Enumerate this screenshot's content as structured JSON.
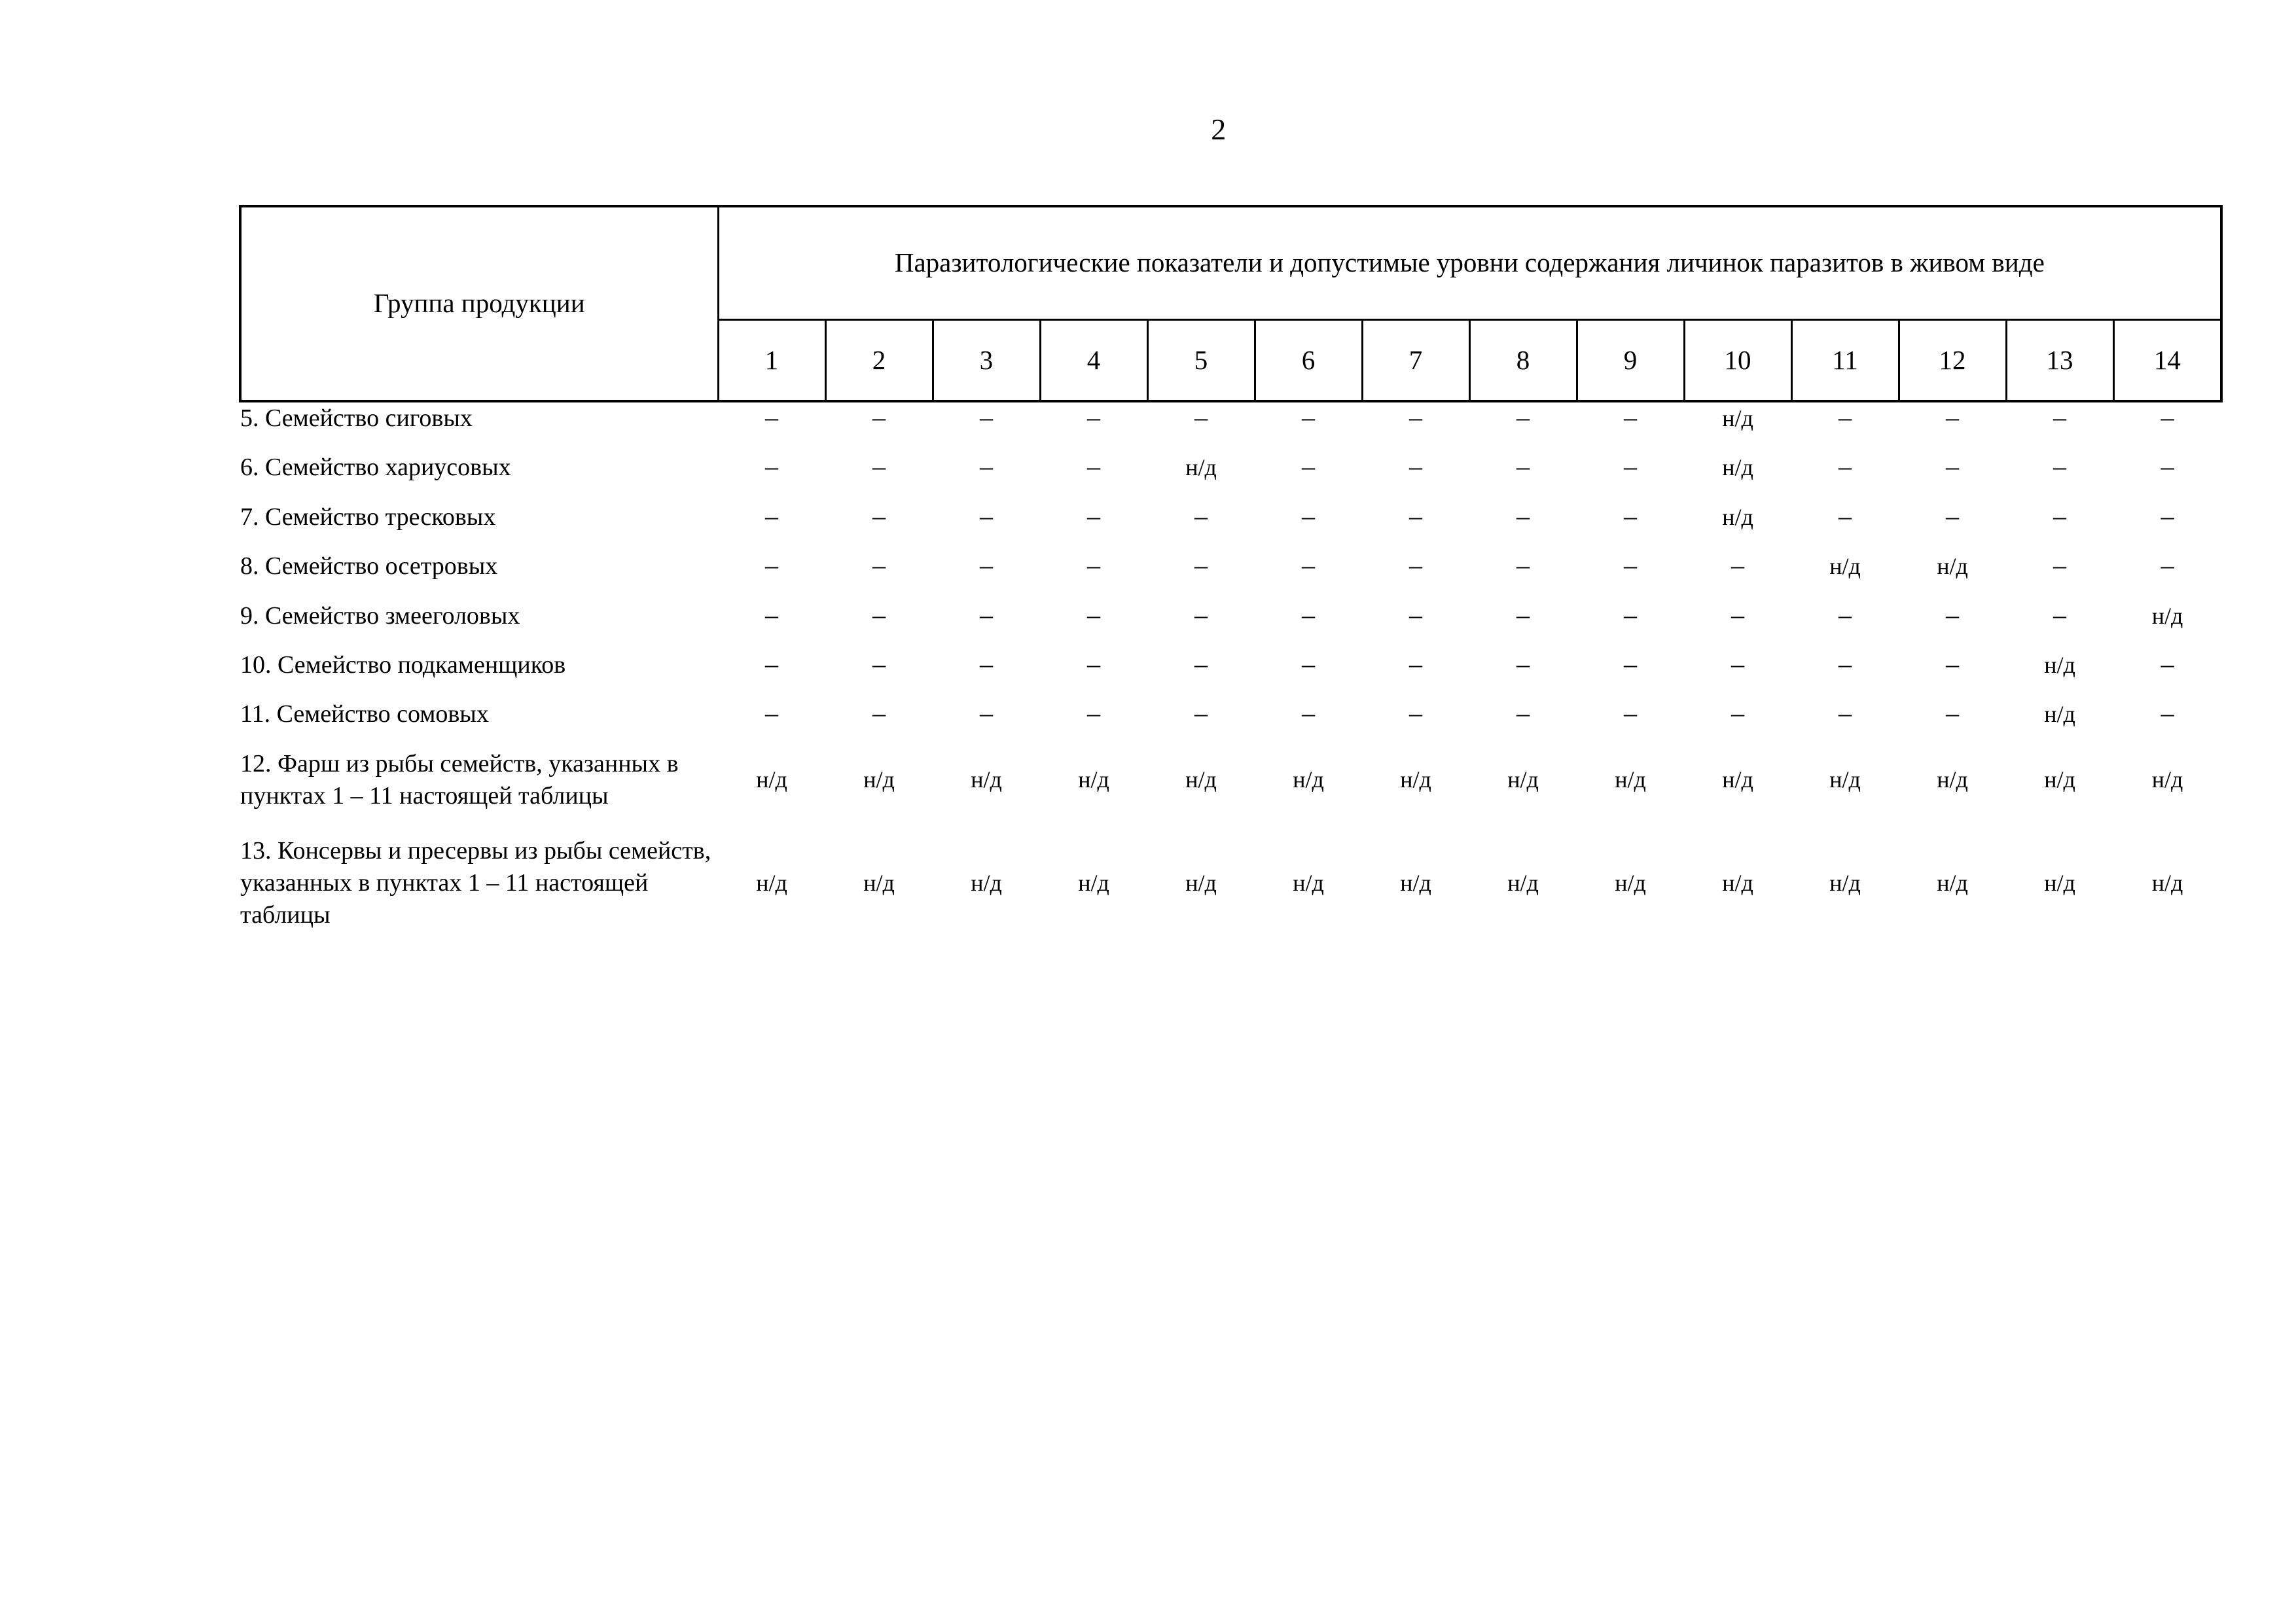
{
  "page": {
    "number": "2"
  },
  "table": {
    "header": {
      "group_column_label": "Группа продукции",
      "span_label": "Паразитологические показатели и допустимые уровни содержания личинок паразитов в живом виде",
      "column_numbers": [
        "1",
        "2",
        "3",
        "4",
        "5",
        "6",
        "7",
        "8",
        "9",
        "10",
        "11",
        "12",
        "13",
        "14"
      ]
    },
    "symbols": {
      "dash": "–",
      "no_data": "н/д"
    },
    "rows": [
      {
        "label": "5. Семейство сиговых",
        "height": "short",
        "values": [
          "–",
          "–",
          "–",
          "–",
          "–",
          "–",
          "–",
          "–",
          "–",
          "н/д",
          "–",
          "–",
          "–",
          "–"
        ]
      },
      {
        "label": "6. Семейство хариусовых",
        "height": "short",
        "values": [
          "–",
          "–",
          "–",
          "–",
          "н/д",
          "–",
          "–",
          "–",
          "–",
          "н/д",
          "–",
          "–",
          "–",
          "–"
        ]
      },
      {
        "label": "7. Семейство тресковых",
        "height": "short",
        "values": [
          "–",
          "–",
          "–",
          "–",
          "–",
          "–",
          "–",
          "–",
          "–",
          "н/д",
          "–",
          "–",
          "–",
          "–"
        ]
      },
      {
        "label": "8. Семейство осетровых",
        "height": "short",
        "values": [
          "–",
          "–",
          "–",
          "–",
          "–",
          "–",
          "–",
          "–",
          "–",
          "–",
          "н/д",
          "н/д",
          "–",
          "–"
        ]
      },
      {
        "label": "9. Семейство змееголовых",
        "height": "short",
        "values": [
          "–",
          "–",
          "–",
          "–",
          "–",
          "–",
          "–",
          "–",
          "–",
          "–",
          "–",
          "–",
          "–",
          "н/д"
        ]
      },
      {
        "label": "10. Семейство подкаменщиков",
        "height": "short",
        "values": [
          "–",
          "–",
          "–",
          "–",
          "–",
          "–",
          "–",
          "–",
          "–",
          "–",
          "–",
          "–",
          "н/д",
          "–"
        ]
      },
      {
        "label": "11. Семейство сомовых",
        "height": "short",
        "values": [
          "–",
          "–",
          "–",
          "–",
          "–",
          "–",
          "–",
          "–",
          "–",
          "–",
          "–",
          "–",
          "н/д",
          "–"
        ]
      },
      {
        "label": "12. Фарш из рыбы семейств, указанных в пунктах 1 – 11 настоящей таблицы",
        "height": "tall",
        "values": [
          "н/д",
          "н/д",
          "н/д",
          "н/д",
          "н/д",
          "н/д",
          "н/д",
          "н/д",
          "н/д",
          "н/д",
          "н/д",
          "н/д",
          "н/д",
          "н/д"
        ]
      },
      {
        "label": "13. Консервы и пресервы из рыбы семейств, указанных в пунктах 1 – 11 настоящей таблицы",
        "height": "tall",
        "values": [
          "н/д",
          "н/д",
          "н/д",
          "н/д",
          "н/д",
          "н/д",
          "н/д",
          "н/д",
          "н/д",
          "н/д",
          "н/д",
          "н/д",
          "н/д",
          "н/д"
        ]
      }
    ]
  }
}
